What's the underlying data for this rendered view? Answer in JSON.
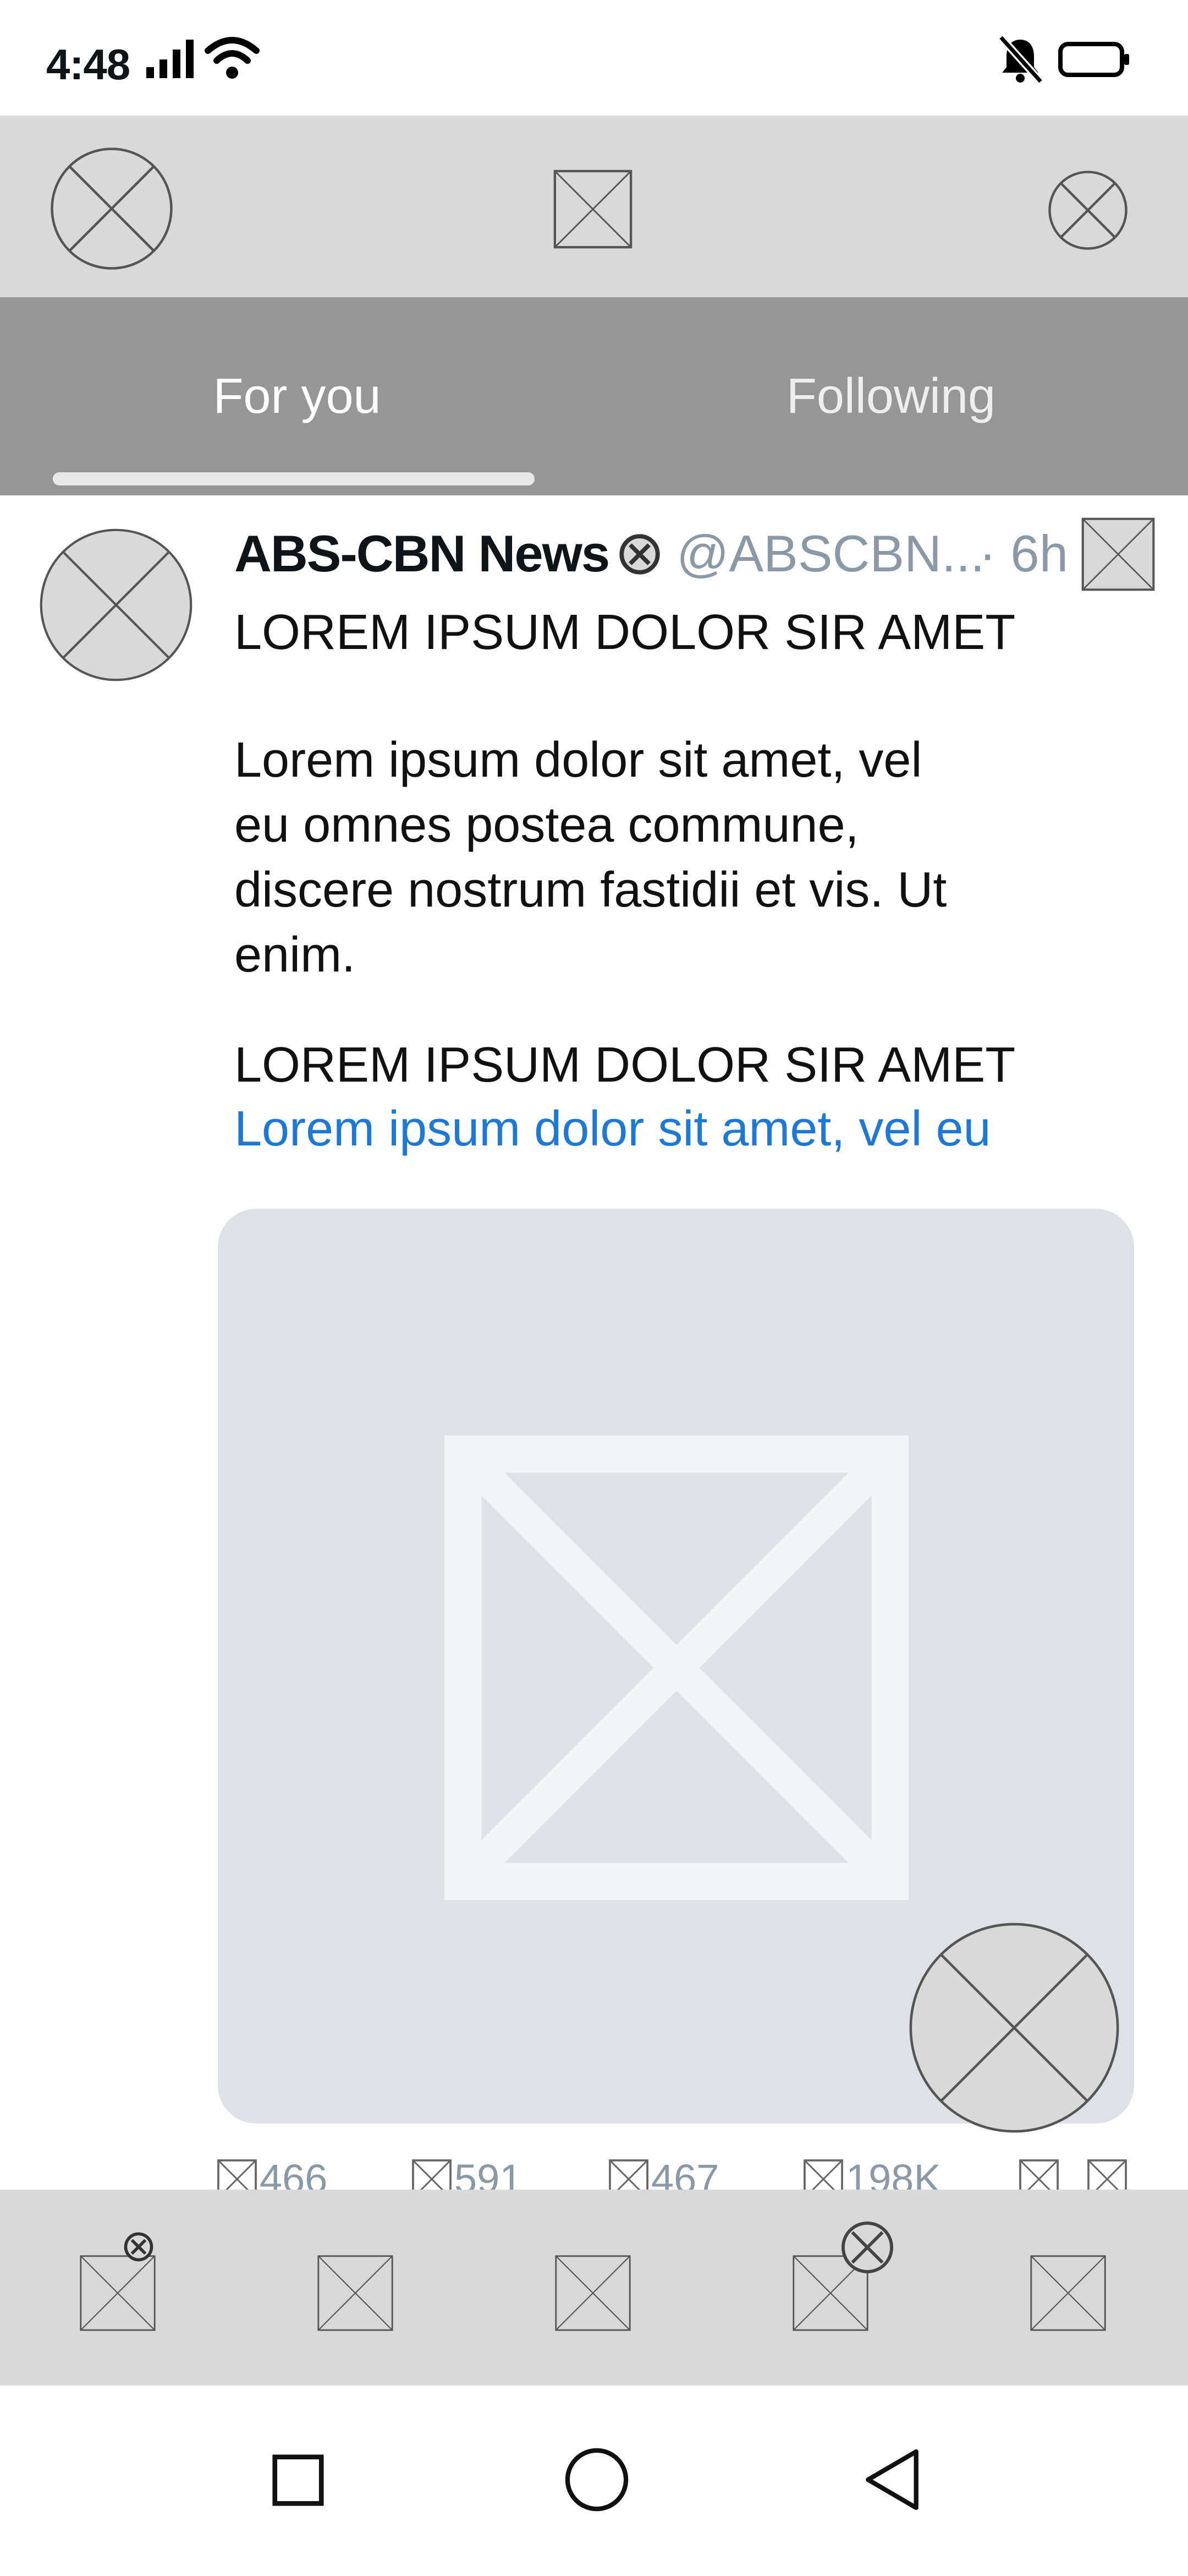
{
  "status_bar": {
    "time": "4:48",
    "icons": [
      "signal-icon",
      "wifi-icon",
      "bell-muted-icon",
      "battery-icon"
    ]
  },
  "top_bar": {
    "icons": [
      "profile-avatar-icon",
      "logo-icon",
      "settings-icon"
    ]
  },
  "tabs": [
    {
      "label": "For you",
      "selected": true
    },
    {
      "label": "Following",
      "selected": false
    }
  ],
  "post": {
    "author_name": "ABS-CBN News",
    "handle": "@ABSCBN...",
    "time": "· 6h",
    "headline": "LOREM IPSUM DOLOR SIR AMET",
    "body_lines": [
      "Lorem ipsum dolor sit amet, vel",
      "eu omnes postea commune,",
      "discere nostrum fastidii et vis. Ut",
      "enim."
    ],
    "subheadline": "LOREM IPSUM DOLOR SIR AMET",
    "link_text": "Lorem ipsum dolor sit amet, vel eu",
    "stats": [
      {
        "icon": "reply-icon",
        "value": "466"
      },
      {
        "icon": "repost-icon",
        "value": "591"
      },
      {
        "icon": "like-icon",
        "value": "467"
      },
      {
        "icon": "views-icon",
        "value": "198K"
      },
      {
        "icon": "bookmark-icon",
        "value": ""
      },
      {
        "icon": "share-icon",
        "value": ""
      }
    ]
  },
  "bottom_tabs": [
    "home-icon",
    "search-icon",
    "communities-icon",
    "notifications-icon",
    "messages-icon"
  ],
  "colors": {
    "top_bar": "#d9d9d9",
    "tabs_bar": "#969696",
    "link": "#1d78d6",
    "muted_text": "#8b98a5",
    "media_bg": "#dee1e5"
  }
}
